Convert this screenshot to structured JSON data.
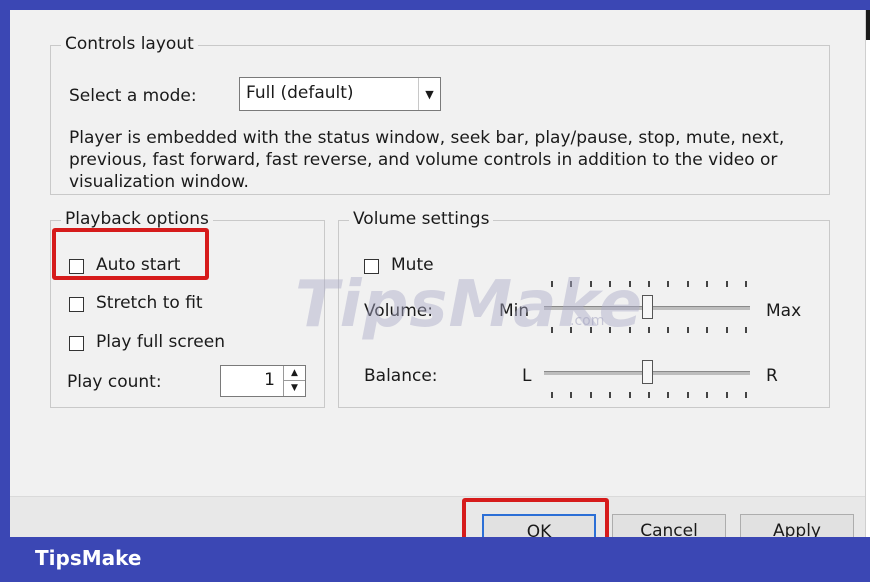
{
  "controls_layout": {
    "legend": "Controls layout",
    "mode_label": "Select a mode:",
    "mode_value": "Full (default)",
    "description": "Player is embedded with the status window, seek bar, play/pause, stop, mute, next, previous, fast forward, fast reverse, and volume controls in addition to the video or visualization window."
  },
  "playback_options": {
    "legend": "Playback options",
    "auto_start": {
      "label": "Auto start",
      "checked": false
    },
    "stretch_to_fit": {
      "label": "Stretch to fit",
      "checked": false
    },
    "play_full_screen": {
      "label": "Play full screen",
      "checked": false
    },
    "play_count_label": "Play count:",
    "play_count_value": "1"
  },
  "volume_settings": {
    "legend": "Volume settings",
    "mute": {
      "label": "Mute",
      "checked": false
    },
    "volume_label": "Volume:",
    "volume_min": "Min",
    "volume_max": "Max",
    "volume_level": 0.5,
    "balance_label": "Balance:",
    "balance_left": "L",
    "balance_right": "R",
    "balance_level": 0.5
  },
  "buttons": {
    "ok": "OK",
    "cancel": "Cancel",
    "apply": "Apply"
  },
  "banner": {
    "text": "TipsMake"
  },
  "watermark": {
    "text": "TipsMake",
    "sub": ".com"
  },
  "colors": {
    "highlight": "#d61b1b",
    "banner": "#3b47b4"
  }
}
